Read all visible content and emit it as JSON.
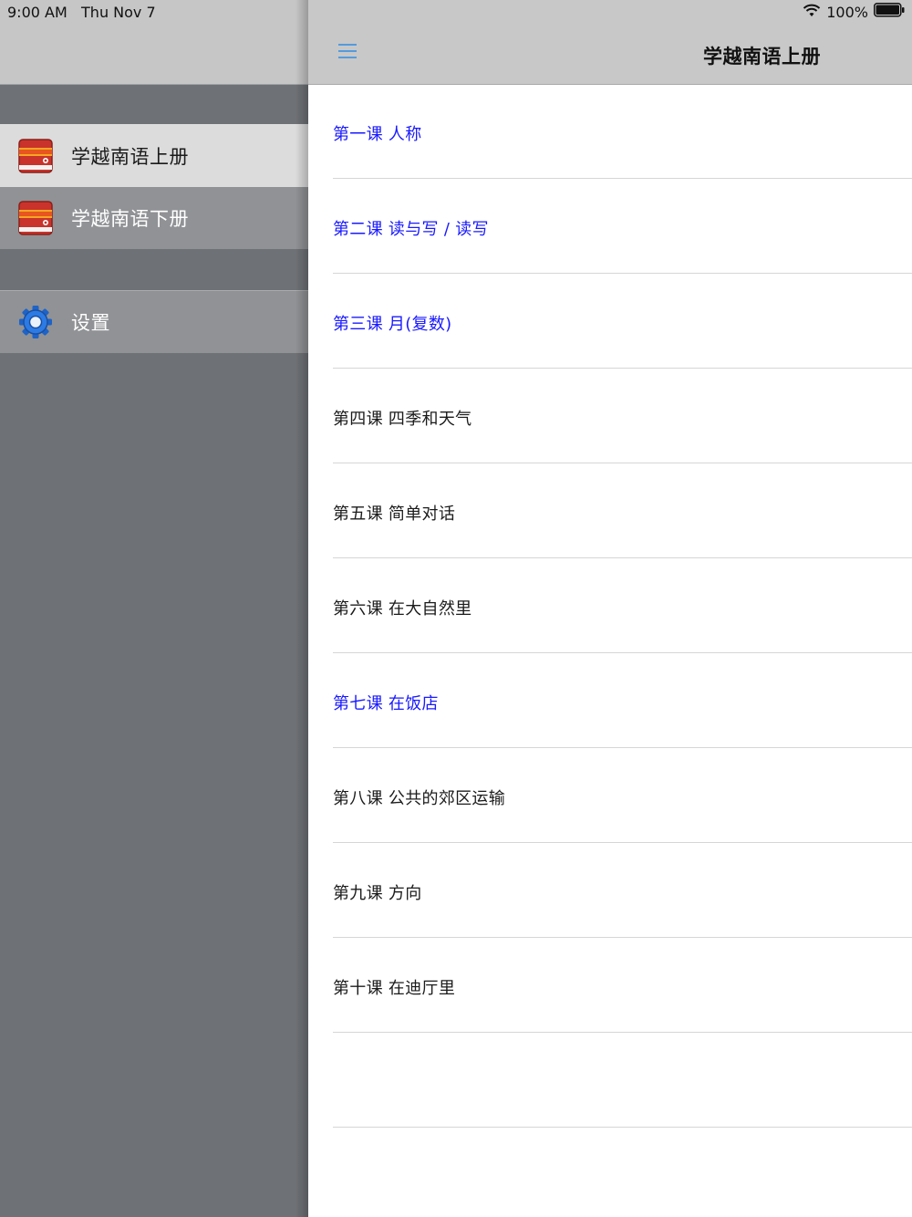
{
  "status_bar": {
    "time": "9:00 AM",
    "date": "Thu Nov 7",
    "battery": "100%"
  },
  "sidebar": {
    "items": [
      {
        "label": "学越南语上册",
        "icon": "book-icon"
      },
      {
        "label": "学越南语下册",
        "icon": "book-icon"
      },
      {
        "label": "设置",
        "icon": "gear-icon"
      }
    ]
  },
  "nav": {
    "title": "学越南语上册",
    "menu_icon": "hamburger-menu-icon"
  },
  "colors": {
    "accent_blue": "#1a1aff",
    "text_default": "#1b1b1b",
    "sidebar_bg": "#6e7175",
    "nav_bg": "#c8c8c8"
  },
  "lessons": [
    {
      "label": "第一课 人称",
      "color": "#1a1aff"
    },
    {
      "label": "第二课 读与写 / 读写",
      "color": "#1a1aff"
    },
    {
      "label": "第三课 月(复数)",
      "color": "#1a1aff"
    },
    {
      "label": "第四课 四季和天气",
      "color": "#1b1b1b"
    },
    {
      "label": "第五课 简单对话",
      "color": "#1b1b1b"
    },
    {
      "label": "第六课 在大自然里",
      "color": "#1b1b1b"
    },
    {
      "label": "第七课 在饭店",
      "color": "#1a1aff"
    },
    {
      "label": "第八课 公共的郊区运输",
      "color": "#1b1b1b"
    },
    {
      "label": "第九课 方向",
      "color": "#1b1b1b"
    },
    {
      "label": "第十课 在迪厅里",
      "color": "#1b1b1b"
    },
    {
      "label": "",
      "color": "#1b1b1b"
    }
  ]
}
